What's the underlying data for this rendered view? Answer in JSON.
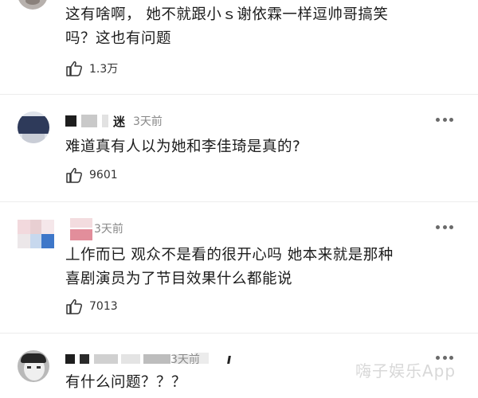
{
  "comments": [
    {
      "text_line1": "这有啥啊， 她不就跟小ｓ谢依霖一样逗帅哥搞笑",
      "text_line2": "吗？这也有问题",
      "likes": "1.3万",
      "icon": "thumbs-up-icon"
    },
    {
      "username": "迷",
      "time": "3天前",
      "text_line1": "难道真有人以为她和李佳琦是真的?",
      "likes": "9601",
      "icon": "thumbs-up-icon"
    },
    {
      "time": "3天前",
      "text_line1": "丄作而已 观众不是看的很开心吗 她本来就是那种",
      "text_line2": "喜剧演员为了节目效果什么都能说",
      "likes": "7013",
      "icon": "thumbs-up-icon"
    },
    {
      "time": "3天前",
      "text_line1": "有什么问题？？？"
    }
  ],
  "watermark": "嗨子娱乐App",
  "colors": {
    "text": "#1c1c1c",
    "meta": "#888888",
    "divider": "#ececec",
    "dots": "#6a6a6a"
  }
}
